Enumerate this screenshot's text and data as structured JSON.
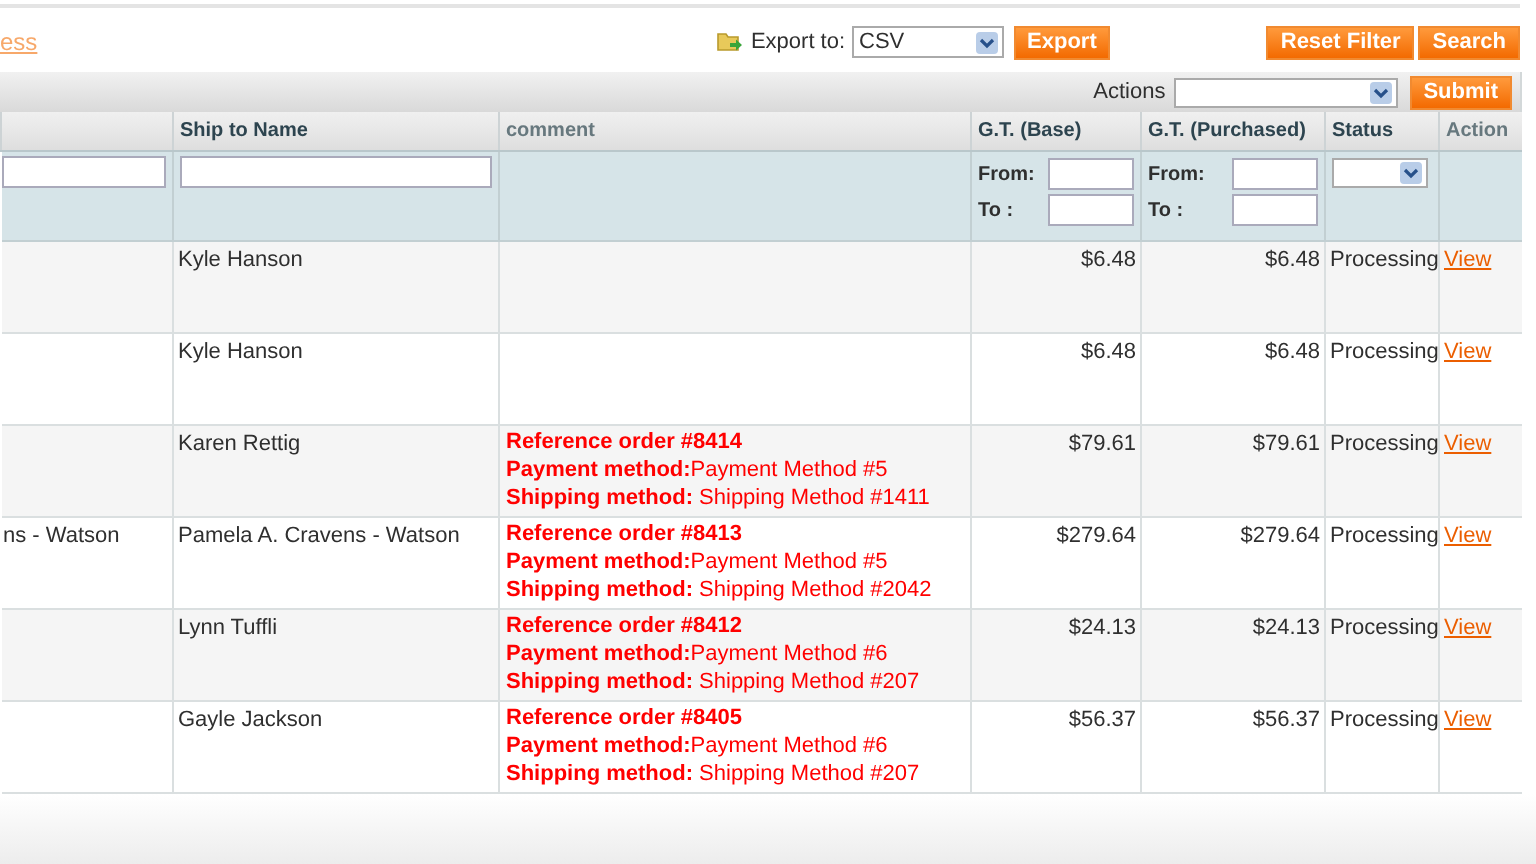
{
  "top_link": "ess",
  "export": {
    "label": "Export to:",
    "format": "CSV",
    "button": "Export"
  },
  "buttons": [
    "Reset Filter",
    "Search"
  ],
  "actions": {
    "label": "Actions",
    "button": "Submit"
  },
  "columns": [
    "Ship to Name",
    "comment",
    "G.T. (Base)",
    "G.T. (Purchased)",
    "Status",
    "Action"
  ],
  "range_filters": [
    {
      "from_label": "From:",
      "to_label": "To :"
    },
    {
      "from_label": "From:",
      "to_label": "To :"
    }
  ],
  "rows": [
    {
      "column_1": "",
      "ship_to": "Kyle Hanson",
      "comment": [],
      "gt_base": "$6.48",
      "gt_purchased": "$6.48",
      "status": "Processing",
      "action": "View"
    },
    {
      "column_1": "",
      "ship_to": "Kyle Hanson",
      "comment": [],
      "gt_base": "$6.48",
      "gt_purchased": "$6.48",
      "status": "Processing",
      "action": "View"
    },
    {
      "column_1": "",
      "ship_to": "Karen Rettig",
      "comment": [
        "**Reference order #8414**",
        "**Payment method:**Payment Method #5",
        "**Shipping method:** Shipping Method #1411"
      ],
      "gt_base": "$79.61",
      "gt_purchased": "$79.61",
      "status": "Processing",
      "action": "View"
    },
    {
      "column_1": "ns - Watson",
      "ship_to": "Pamela A. Cravens - Watson",
      "comment": [
        "**Reference order #8413**",
        "**Payment method:**Payment Method #5",
        "**Shipping method:** Shipping Method #2042"
      ],
      "gt_base": "$279.64",
      "gt_purchased": "$279.64",
      "status": "Processing",
      "action": "View"
    },
    {
      "column_1": "",
      "ship_to": "Lynn Tuffli",
      "comment": [
        "**Reference order #8412**",
        "**Payment method:**Payment Method #6",
        "**Shipping method:** Shipping Method #207"
      ],
      "gt_base": "$24.13",
      "gt_purchased": "$24.13",
      "status": "Processing",
      "action": "View"
    },
    {
      "column_1": "",
      "ship_to": "Gayle Jackson",
      "comment": [
        "**Reference order #8405**",
        "**Payment method:**Payment Method #6",
        "**Shipping method:** Shipping Method #207"
      ],
      "gt_base": "$56.37",
      "gt_purchased": "$56.37",
      "status": "Processing",
      "action": "View"
    }
  ]
}
